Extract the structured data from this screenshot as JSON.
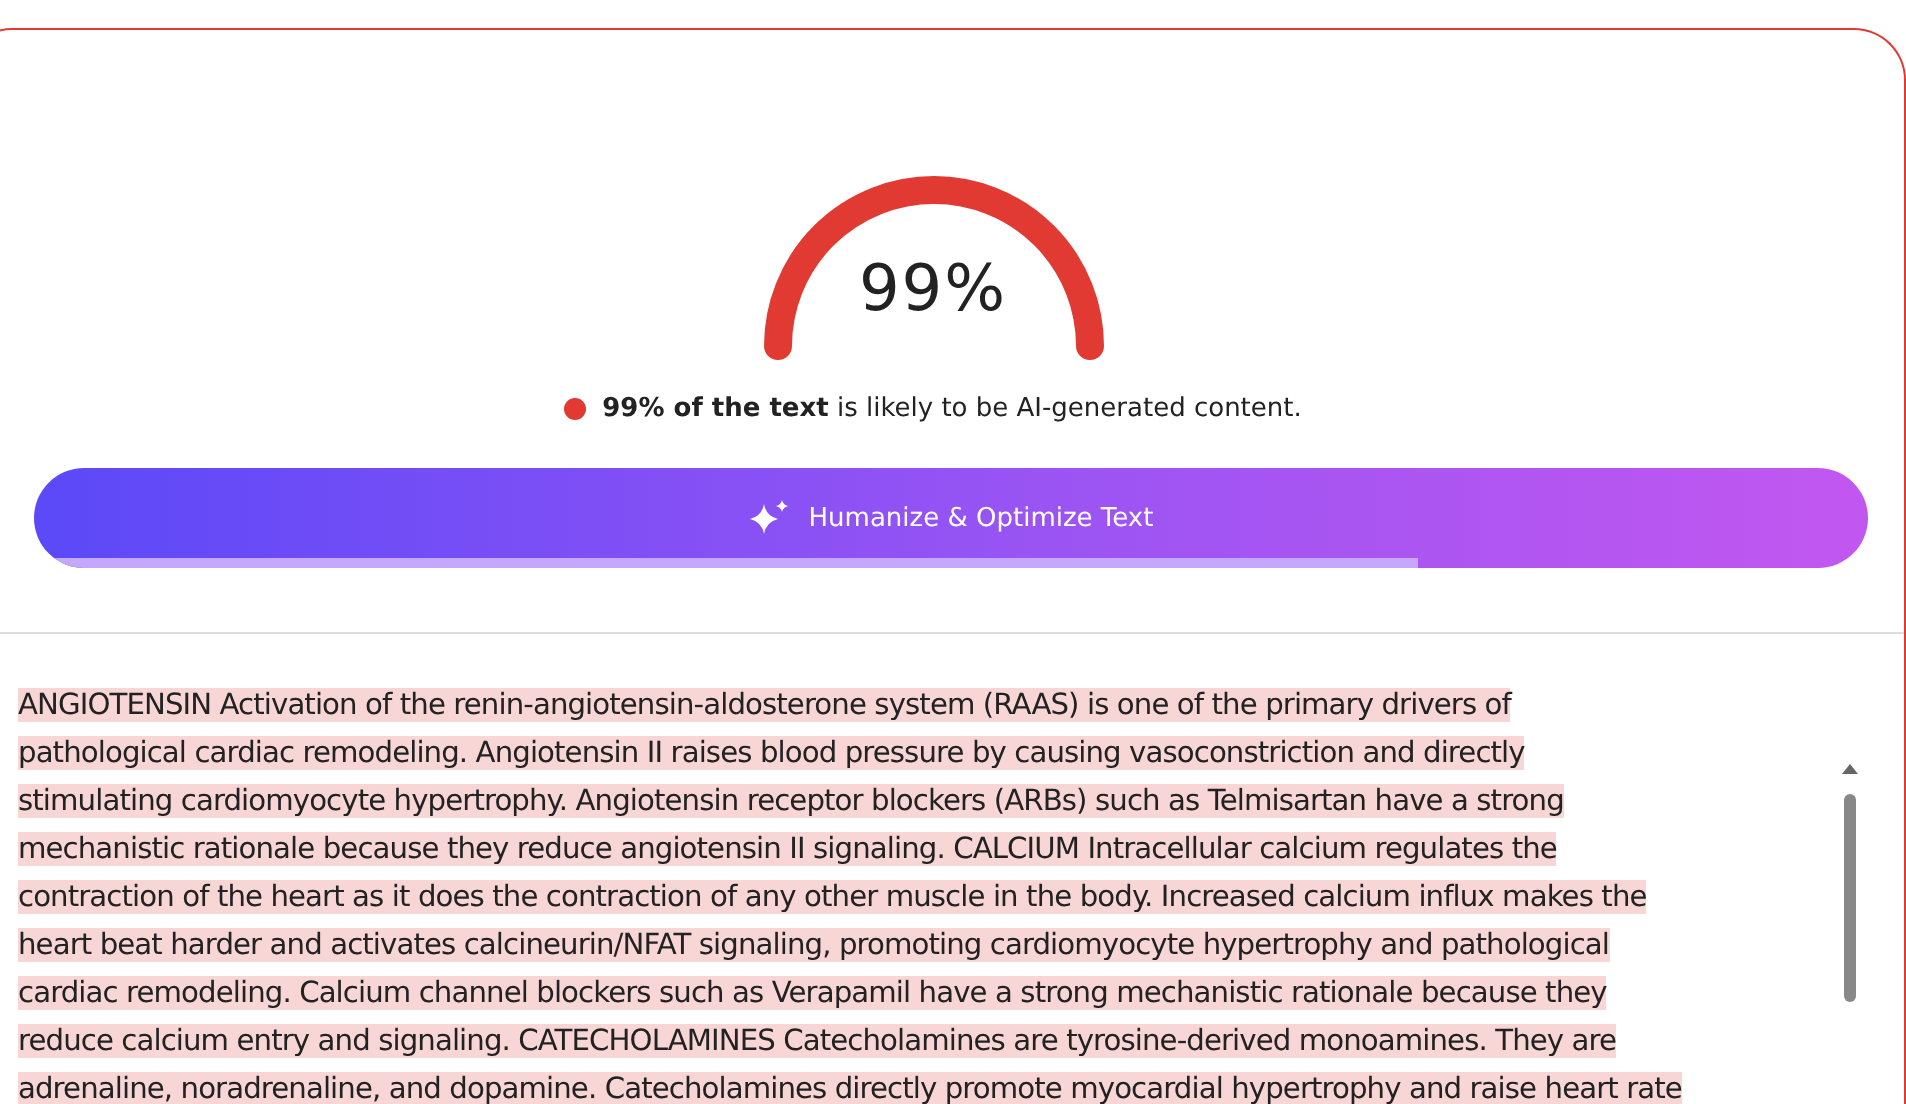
{
  "gauge": {
    "reading": "99%"
  },
  "verdict": {
    "color": "#e03a33",
    "text": "**99% of the text** is likely to be AI-generated content."
  },
  "humanize_button": {
    "label": "Humanize & Optimize Text",
    "level": 0.755
  },
  "passage": {
    "lines": [
      "ANGIOTENSIN Activation of the renin-angiotensin-aldosterone system (RAAS) is one of the primary drivers of",
      "pathological cardiac remodeling. Angiotensin II raises blood pressure by causing vasoconstriction and directly",
      "stimulating cardiomyocyte hypertrophy. Angiotensin receptor blockers (ARBs) such as Telmisartan have a strong",
      "mechanistic rationale because they reduce angiotensin II signaling. CALCIUM Intracellular calcium regulates the",
      "contraction of the heart as it does the contraction of any other muscle in the body. Increased calcium influx makes the",
      "heart beat harder and activates calcineurin/NFAT signaling, promoting cardiomyocyte hypertrophy and pathological",
      "cardiac remodeling. Calcium channel blockers such as Verapamil have a strong mechanistic rationale because they",
      "reduce calcium entry and signaling. CATECHOLAMINES Catecholamines are tyrosine-derived monoamines. They are",
      "adrenaline, noradrenaline, and dopamine. Catecholamines directly promote myocardial hypertrophy and raise heart rate"
    ],
    "highlighted": true
  }
}
